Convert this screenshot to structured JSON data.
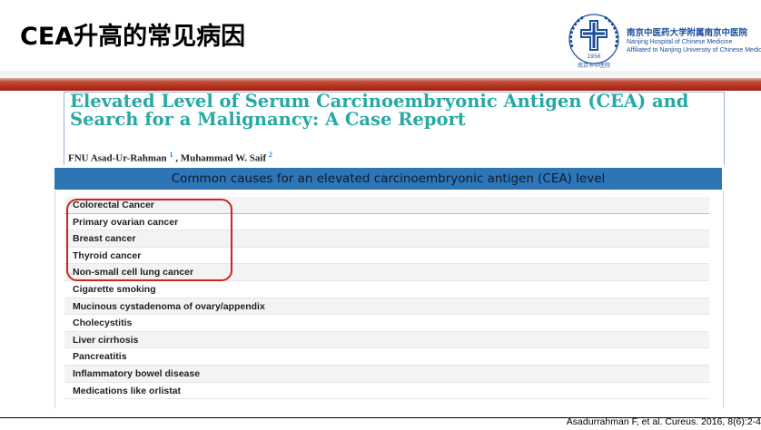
{
  "slide": {
    "title": "CEA升高的常见病因"
  },
  "logo": {
    "name_cn": "南京中医药大学附属南京中医院",
    "name_en_line1": "Nanjing Hospital of Chinese Medicine",
    "name_en_line2": "Affiliated to Nanjing University of Chinese Medicine",
    "year": "1956",
    "seal_text": "南京市中医院",
    "accent_color": "#1d4e9a"
  },
  "paper": {
    "title": "Elevated Level of Serum Carcinoembryonic Antigen (CEA) and Search for a Malignancy: A Case Report",
    "author1": "FNU Asad-Ur-Rahman",
    "author1_sup": "1",
    "separator": " , ",
    "author2": "Muhammad W. Saif",
    "author2_sup": "2",
    "title_color": "#28a9a4"
  },
  "table": {
    "caption": "Common causes for an elevated carcinoembryonic antigen (CEA) level",
    "header_color": "#2e75b6",
    "rows": [
      "Colorectal Cancer",
      "Primary ovarian cancer",
      "Breast cancer",
      "Thyroid cancer",
      "Non-small cell lung cancer",
      "Cigarette smoking",
      "Mucinous cystadenoma of ovary/appendix",
      "Cholecystitis",
      "Liver cirrhosis",
      "Pancreatitis",
      "Inflammatory bowel disease",
      "Medications like orlistat"
    ]
  },
  "highlight": {
    "color": "#d0221f"
  },
  "citation": "Asadurrahman F, et al. Cureus. 2016, 8(6):2-4"
}
